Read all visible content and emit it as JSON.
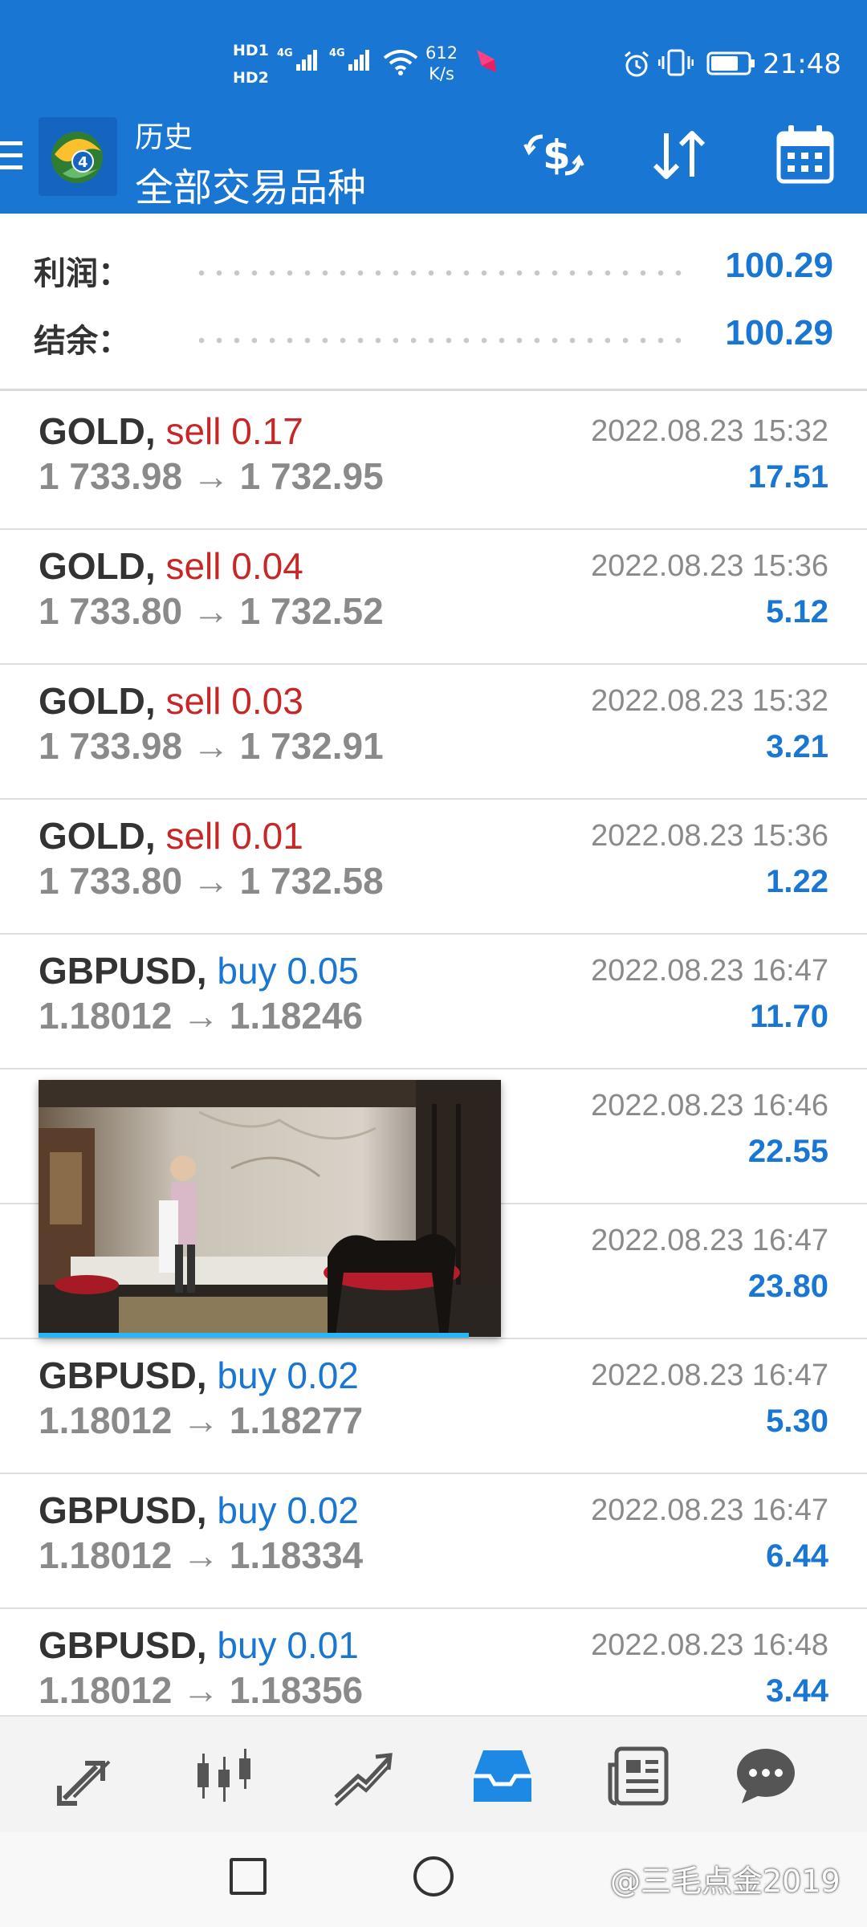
{
  "status_bar": {
    "hd1": "HD1",
    "hd2": "HD2",
    "net1": "4G",
    "net2": "4G",
    "speed_value": "612",
    "speed_unit": "K/s",
    "battery_level": 0.75,
    "time": "21:48"
  },
  "header": {
    "title": "历史",
    "subtitle": "全部交易品种",
    "icons": [
      "menu-icon",
      "mt4-logo-icon",
      "deposit-dollar-icon",
      "sort-arrows-icon",
      "calendar-icon"
    ]
  },
  "summary": {
    "profit_label": "利润：",
    "profit_value": "100.29",
    "balance_label": "结余：",
    "balance_value": "100.29"
  },
  "trades": [
    {
      "symbol": "GOLD,",
      "direction": "sell",
      "lot": "0.17",
      "open": "1 733.98",
      "close": "1 732.95",
      "date": "2022.08.23 15:32",
      "profit": "17.51"
    },
    {
      "symbol": "GOLD,",
      "direction": "sell",
      "lot": "0.04",
      "open": "1 733.80",
      "close": "1 732.52",
      "date": "2022.08.23 15:36",
      "profit": "5.12"
    },
    {
      "symbol": "GOLD,",
      "direction": "sell",
      "lot": "0.03",
      "open": "1 733.98",
      "close": "1 732.91",
      "date": "2022.08.23 15:32",
      "profit": "3.21"
    },
    {
      "symbol": "GOLD,",
      "direction": "sell",
      "lot": "0.01",
      "open": "1 733.80",
      "close": "1 732.58",
      "date": "2022.08.23 15:36",
      "profit": "1.22"
    },
    {
      "symbol": "GBPUSD,",
      "direction": "buy",
      "lot": "0.05",
      "open": "1.18012",
      "close": "1.18246",
      "date": "2022.08.23 16:47",
      "profit": "11.70"
    },
    {
      "symbol": "",
      "direction": "",
      "lot": "",
      "open": "",
      "close": "",
      "date": "2022.08.23 16:46",
      "profit": "22.55"
    },
    {
      "symbol": "",
      "direction": "",
      "lot": "",
      "open": "",
      "close": "",
      "date": "2022.08.23 16:47",
      "profit": "23.80"
    },
    {
      "symbol": "GBPUSD,",
      "direction": "buy",
      "lot": "0.02",
      "open": "1.18012",
      "close": "1.18277",
      "date": "2022.08.23 16:47",
      "profit": "5.30"
    },
    {
      "symbol": "GBPUSD,",
      "direction": "buy",
      "lot": "0.02",
      "open": "1.18012",
      "close": "1.18334",
      "date": "2022.08.23 16:47",
      "profit": "6.44"
    },
    {
      "symbol": "GBPUSD,",
      "direction": "buy",
      "lot": "0.01",
      "open": "1.18012",
      "close": "1.18356",
      "date": "2022.08.23 16:48",
      "profit": "3.44"
    }
  ],
  "arrow": "→",
  "video_overlay": {
    "progress": 0.93
  },
  "bottom_nav": {
    "items": [
      "quotes-icon",
      "chart-icon",
      "trade-icon",
      "history-icon",
      "news-icon",
      "chat-icon"
    ],
    "active": "history-icon",
    "active_color": "#1e88e5",
    "inactive_color": "#555555"
  },
  "system_nav": {
    "watermark": "@三毛点金2019"
  },
  "colors": {
    "header_bg": "#1976d2",
    "accent": "#1976d2",
    "sell": "#c62828",
    "buy": "#1976d2"
  }
}
